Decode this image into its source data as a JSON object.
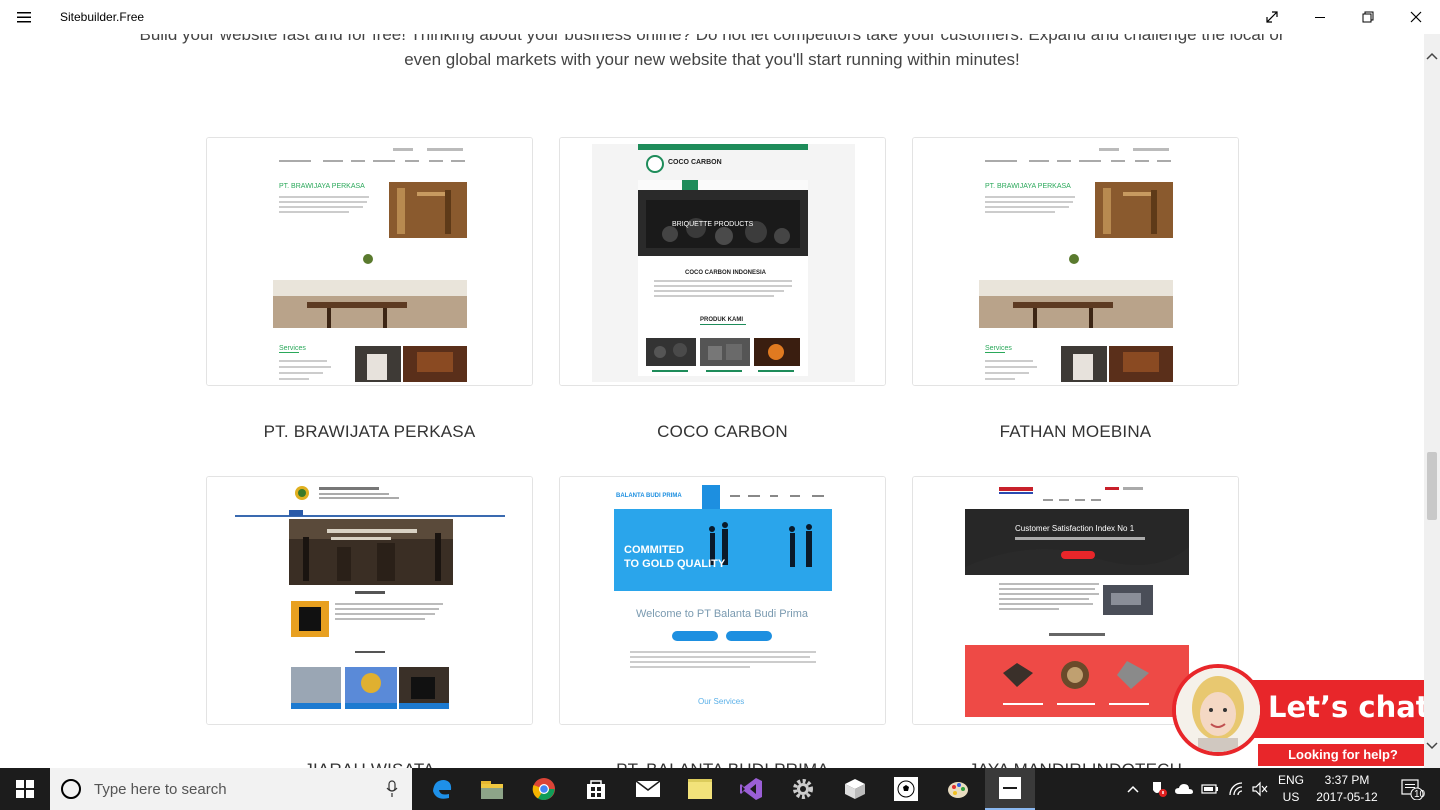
{
  "window": {
    "title": "Sitebuilder.Free"
  },
  "intro": {
    "line1": "Build your website fast and for free! Thinking about your business online? Do not let competitors take your customers. Expand and challenge the local or",
    "line2": "even global markets with your new website that you'll start running within minutes!"
  },
  "templates": [
    {
      "name": "PT. BRAWIJATA PERKASA"
    },
    {
      "name": "COCO CARBON"
    },
    {
      "name": "FATHAN MOEBINA"
    },
    {
      "name": "JIARAH WISATA"
    },
    {
      "name": "PT. BALANTA BUDI PRIMA"
    },
    {
      "name": "JAYA MANDIRI INDOTECH"
    }
  ],
  "previews": {
    "brawijata_heading": "PT. BRAWIJAYA PERKASA",
    "services": "Services",
    "coco_logo": "COCO CARBON",
    "coco_banner": "BRIQUETTE PRODUCTS",
    "coco_heading": "COCO CARBON INDONESIA",
    "coco_products": "PRODUK KAMI",
    "balanta_logo": "BALANTA BUDI PRIMA",
    "balanta_banner_1": "COMMITED",
    "balanta_banner_2": "TO GOLD QUALITY",
    "balanta_welcome": "Welcome to PT Balanta Budi Prima",
    "balanta_services": "Our Services",
    "jaya_banner": "Customer Satisfaction Index No 1"
  },
  "chat": {
    "title": "Let’s chat",
    "subtitle": "Looking for help?"
  },
  "taskbar": {
    "search_placeholder": "Type here to search",
    "language": "ENG",
    "region": "US",
    "time": "3:37 PM",
    "date": "2017-05-12",
    "notification_count": "10"
  },
  "colors": {
    "accent_red": "#e8262a",
    "coco_green": "#1e8c5a",
    "balanta_blue": "#1d8fe0"
  }
}
